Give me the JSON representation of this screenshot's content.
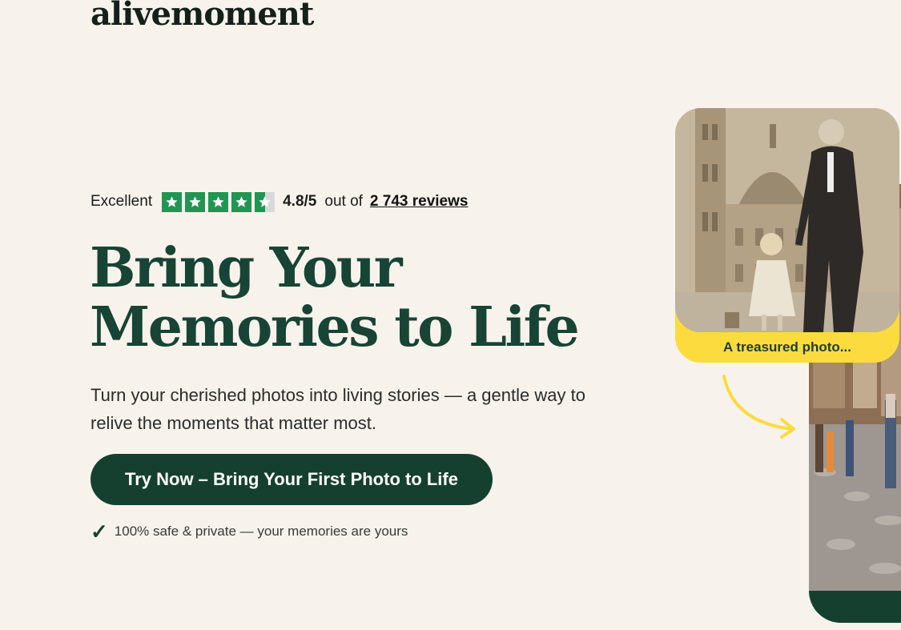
{
  "brand": {
    "logo_text": "alivemoment"
  },
  "rating": {
    "label": "Excellent",
    "stars": 4.5,
    "score": "4.8/5",
    "out_of": "out of",
    "reviews_link": "2 743 reviews",
    "star_color": "#219653"
  },
  "hero": {
    "headline_line1": "Bring Your",
    "headline_line2": "Memories to Life",
    "subtitle": "Turn your cherished photos into living stories — a gentle way to relive the moments that matter most.",
    "cta_label": "Try Now – Bring Your First Photo to Life",
    "safety_note": "100% safe & private — your memories are yours"
  },
  "visual": {
    "before_caption": "A treasured photo...",
    "accent_yellow": "#fcdb3e",
    "brand_green": "#15402f"
  }
}
